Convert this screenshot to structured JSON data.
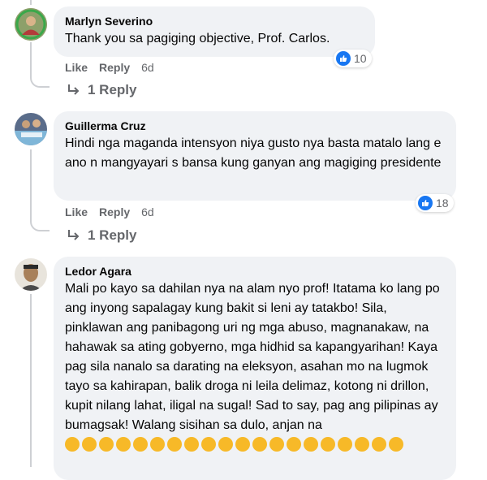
{
  "comments": [
    {
      "author": "Marlyn Severino",
      "text": "Thank you sa pagiging objective, Prof. Carlos.",
      "reaction_count": "10",
      "like_label": "Like",
      "reply_label": "Reply",
      "time": "6d",
      "replies_label": "1 Reply"
    },
    {
      "author": "Guillerma Cruz",
      "text": "Hindi nga maganda intensyon niya gusto nya basta matalo lang e ano n mangyayari s bansa kung ganyan ang magiging presidente",
      "reaction_count": "18",
      "like_label": "Like",
      "reply_label": "Reply",
      "time": "6d",
      "replies_label": "1 Reply"
    },
    {
      "author": "Ledor Agara",
      "text": "Mali po kayo sa dahilan nya na alam nyo prof! Itatama ko lang po ang inyong sapalagay kung bakit si leni ay tatakbo! Sila, pinklawan ang panibagong uri ng mga abuso, magnanakaw, na hahawak sa ating gobyerno, mga hidhid sa kapangyarihan! Kaya pag sila nanalo sa darating na eleksyon, asahan mo na lugmok tayo sa kahirapan, balik droga ni leila delimaz, kotong ni drillon, kupit nilang lahat, iligal na sugal! Sad to say, pag ang pilipinas ay bumagsak! Walang sisihan sa dulo, anjan na"
    }
  ],
  "colors": {
    "bubble": "#f0f2f5",
    "meta": "#65676b",
    "like_blue": "#1877f2",
    "thread_line": "#ced0d4"
  },
  "icons": {
    "reaction": "like-icon",
    "reply_arrow": "reply-arrow-icon"
  }
}
